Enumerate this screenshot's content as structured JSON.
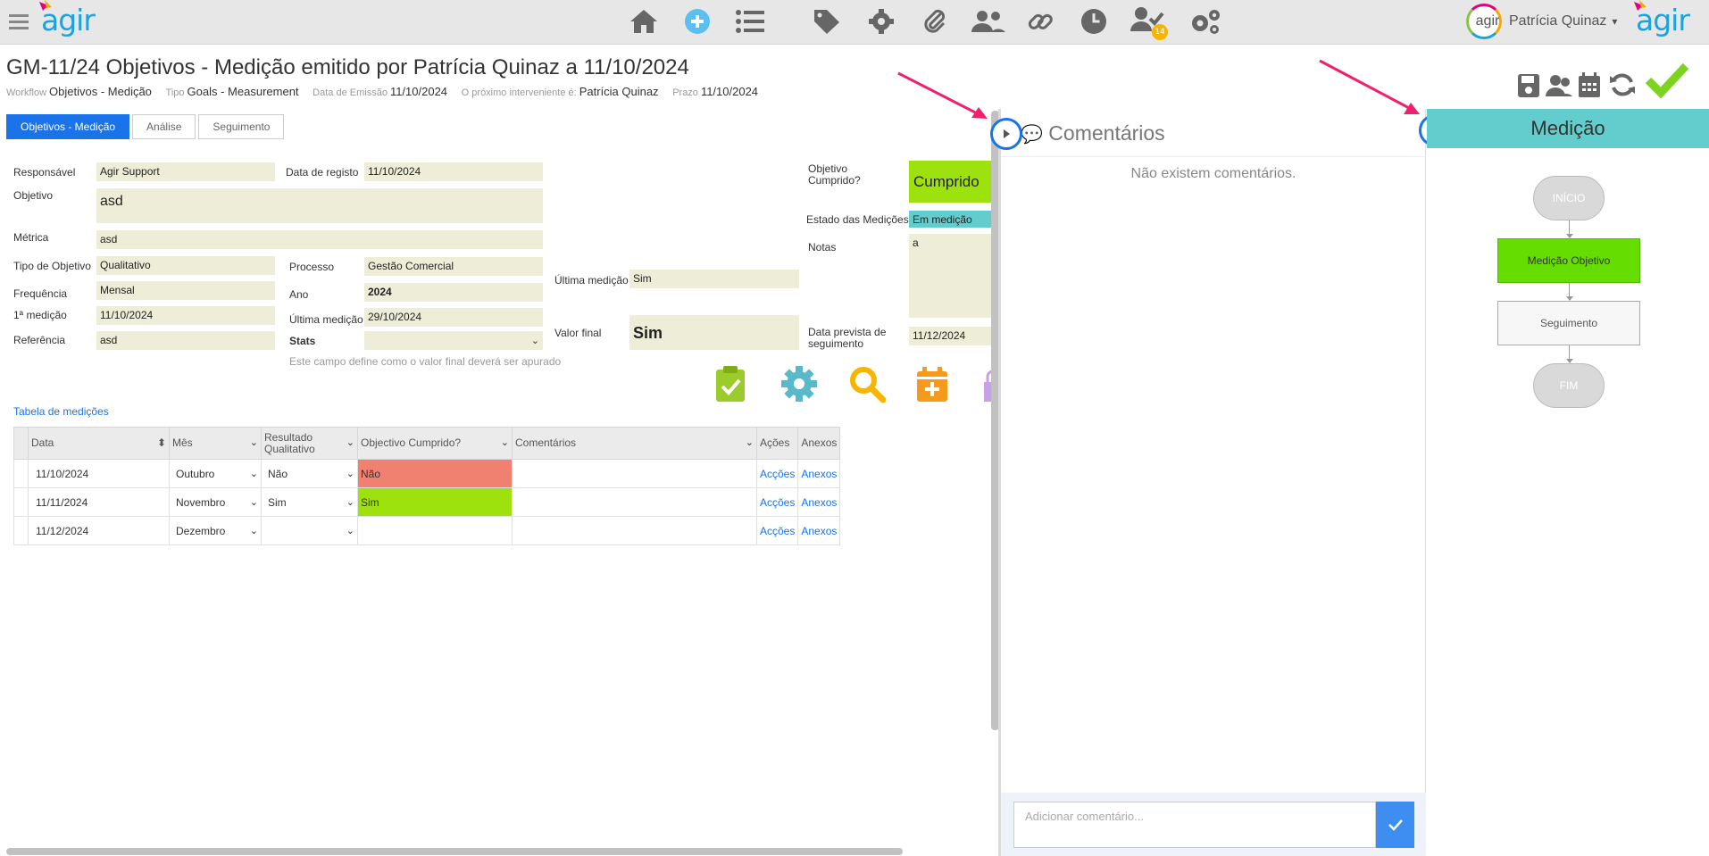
{
  "app": {
    "logo_text": "agir",
    "user_name": "Patrícia Quinaz",
    "avatar_text": "agir",
    "notification_count": "14"
  },
  "document": {
    "title": "GM-11/24 Objetivos - Medição emitido por Patrícia Quinaz a 11/10/2024",
    "meta": [
      {
        "key": "Workflow",
        "value": "Objetivos - Medição"
      },
      {
        "key": "Tipo",
        "value": "Goals - Measurement"
      },
      {
        "key": "Data de Emissão",
        "value": "11/10/2024"
      },
      {
        "key": "O próximo interveniente é:",
        "value": "Patrícia Quinaz"
      },
      {
        "key": "Prazo",
        "value": "11/10/2024"
      }
    ]
  },
  "tabs": [
    "Objetivos - Medição",
    "Análise",
    "Seguimento"
  ],
  "form": {
    "responsavel_label": "Responsável",
    "responsavel": "Agir Support",
    "data_registo_label": "Data de registo",
    "data_registo": "11/10/2024",
    "objetivo_label": "Objetivo",
    "objetivo": "asd",
    "metrica_label": "Métrica",
    "metrica": "asd",
    "tipo_label": "Tipo de Objetivo",
    "tipo": "Qualitativo",
    "processo_label": "Processo",
    "processo": "Gestão Comercial",
    "frequencia_label": "Frequência",
    "frequencia": "Mensal",
    "ano_label": "Ano",
    "ano": "2024",
    "primeira_label": "1ª medição",
    "primeira": "11/10/2024",
    "ultima_label": "Última medição",
    "ultima": "29/10/2024",
    "referencia_label": "Referência",
    "referencia": "asd",
    "stats_label": "Stats",
    "stats": "",
    "stats_hint": "Este campo define como o valor final deverá ser apurado",
    "ultima_sim_label": "Última medição",
    "ultima_sim": "Sim",
    "valor_final_label": "Valor final",
    "valor_final": "Sim",
    "cumprido_label": "Objetivo Cumprido?",
    "cumprido": "Cumprido",
    "estado_label": "Estado das Medições",
    "estado": "Em medição",
    "notas_label": "Notas",
    "notas": "a",
    "data_prevista_label": "Data prevista de seguimento",
    "data_prevista": "11/12/2024"
  },
  "table": {
    "section_title": "Tabela de medições",
    "headers": [
      "Data",
      "Mês",
      "Resultado Qualitativo",
      "Objectivo Cumprido?",
      "Comentários",
      "Ações",
      "Anexos"
    ],
    "rows": [
      {
        "data": "11/10/2024",
        "mes": "Outubro",
        "resultado": "Não",
        "cumprido": "Não",
        "acoes": "Acções",
        "anexos": "Anexos"
      },
      {
        "data": "11/11/2024",
        "mes": "Novembro",
        "resultado": "Sim",
        "cumprido": "Sim",
        "acoes": "Acções",
        "anexos": "Anexos"
      },
      {
        "data": "11/12/2024",
        "mes": "Dezembro",
        "resultado": "",
        "cumprido": "",
        "acoes": "Acções",
        "anexos": "Anexos"
      }
    ]
  },
  "comments": {
    "title": "Comentários",
    "empty": "Não existem comentários.",
    "placeholder": "Adicionar comentário..."
  },
  "workflow": {
    "title": "Medição",
    "nodes": [
      "INÍCIO",
      "Medição Objetivo",
      "Seguimento",
      "FIM"
    ]
  },
  "colors": {
    "accent": "#1a73e8",
    "brand": "#1ca3dd",
    "success": "#9ee20d",
    "danger": "#f08070",
    "teal": "#63cccc",
    "field": "#eeeed8"
  }
}
